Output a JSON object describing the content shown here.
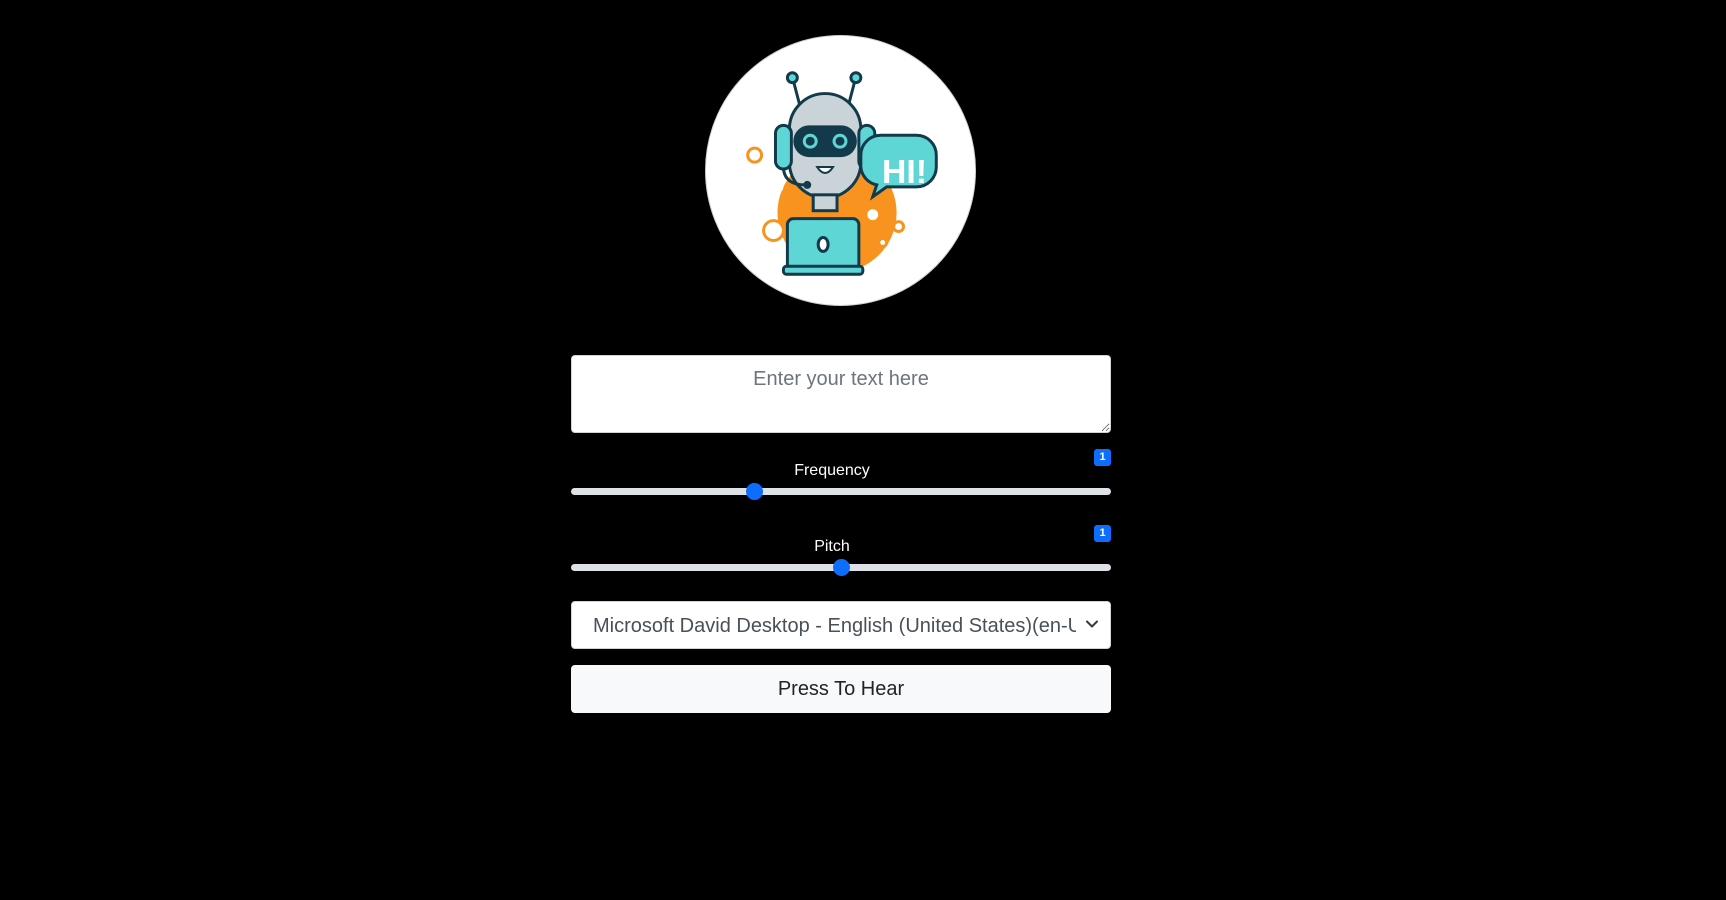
{
  "logo": {
    "icon": "robot-support-icon",
    "speech_bubble_text": "HI!"
  },
  "text_input": {
    "placeholder": "Enter your text here",
    "value": ""
  },
  "frequency": {
    "label": "Frequency",
    "value": "1",
    "min": 0,
    "max": 3,
    "current": 1
  },
  "pitch": {
    "label": "Pitch",
    "value": "1",
    "min": 0,
    "max": 2,
    "current": 1
  },
  "voice_select": {
    "selected": "Microsoft David Desktop - English (United States)(en-US)"
  },
  "hear_button": {
    "label": "Press To Hear"
  },
  "colors": {
    "background": "#000000",
    "accent": "#0d6efd",
    "robot_teal": "#5fd6d6",
    "robot_orange": "#f7931e",
    "button_bg": "#f8f9fa"
  }
}
